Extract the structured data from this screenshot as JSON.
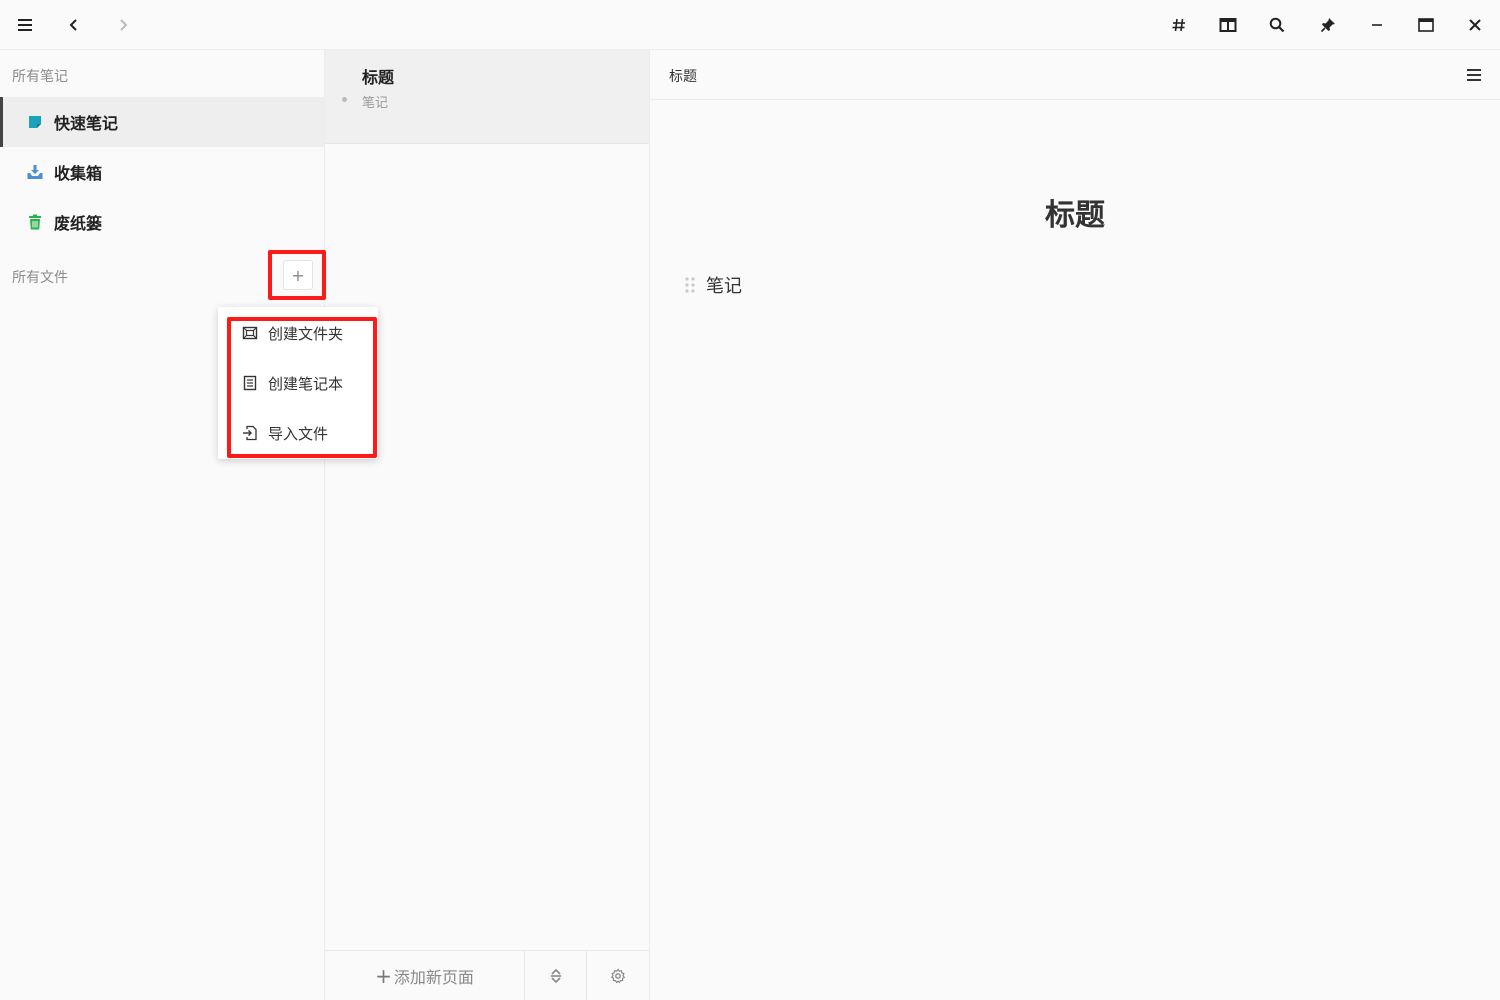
{
  "titlebar": {
    "left_icons": [
      "menu-icon",
      "back-icon",
      "forward-icon"
    ],
    "right_icons": [
      "hashtag-icon",
      "split-view-icon",
      "search-icon",
      "pin-icon",
      "minimize-icon",
      "maximize-icon",
      "close-icon"
    ]
  },
  "sidebar": {
    "notes_header": "所有笔记",
    "items": [
      {
        "label": "快速笔记",
        "icon": "quick-note-icon",
        "color": "#1aa3b8",
        "active": true
      },
      {
        "label": "收集箱",
        "icon": "inbox-icon",
        "color": "#4a8fd4",
        "active": false
      },
      {
        "label": "废纸篓",
        "icon": "trash-icon",
        "color": "#2bb24c",
        "active": false
      }
    ],
    "files_header": "所有文件",
    "add_button": "+"
  },
  "menu": {
    "items": [
      {
        "label": "创建文件夹",
        "icon": "folder-icon"
      },
      {
        "label": "创建笔记本",
        "icon": "notebook-icon"
      },
      {
        "label": "导入文件",
        "icon": "import-icon"
      }
    ]
  },
  "list": {
    "note_title": "标题",
    "note_sub": "笔记",
    "footer": {
      "add_icon": "+",
      "add_page": "添加新页面",
      "sort_icon": "sort-icon",
      "settings_icon": "settings-icon"
    }
  },
  "editor": {
    "breadcrumb": "标题",
    "title": "标题",
    "block_text": "笔记"
  },
  "colors": {
    "highlight": "#ff1a1a",
    "active_bg": "#eeeeee"
  }
}
